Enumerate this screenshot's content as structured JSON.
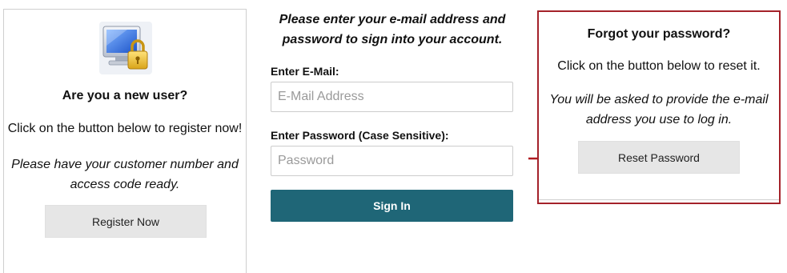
{
  "new_user": {
    "title": "Are you a new user?",
    "text": "Click on the button below to register now!",
    "note": "Please have your customer number and access code ready.",
    "register_label": "Register Now",
    "icon": "computer-lock-icon"
  },
  "login": {
    "heading": "Please enter your e-mail address and password to sign into your account.",
    "email_label": "Enter E-Mail:",
    "email_placeholder": "E-Mail Address",
    "email_value": "",
    "password_label": "Enter Password (Case Sensitive):",
    "password_placeholder": "Password",
    "password_value": "",
    "signin_label": "Sign In"
  },
  "forgot": {
    "title": "Forgot your password?",
    "text": "Click on the button below to reset it.",
    "note": "You will be asked to provide the e-mail address you use to log in.",
    "reset_label": "Reset Password",
    "arrow_icon": "arrow-right-icon"
  },
  "colors": {
    "signin_bg": "#1f6677",
    "highlight_border": "#a4222a",
    "arrow": "#b01c22",
    "button_grey": "#e6e6e6"
  }
}
